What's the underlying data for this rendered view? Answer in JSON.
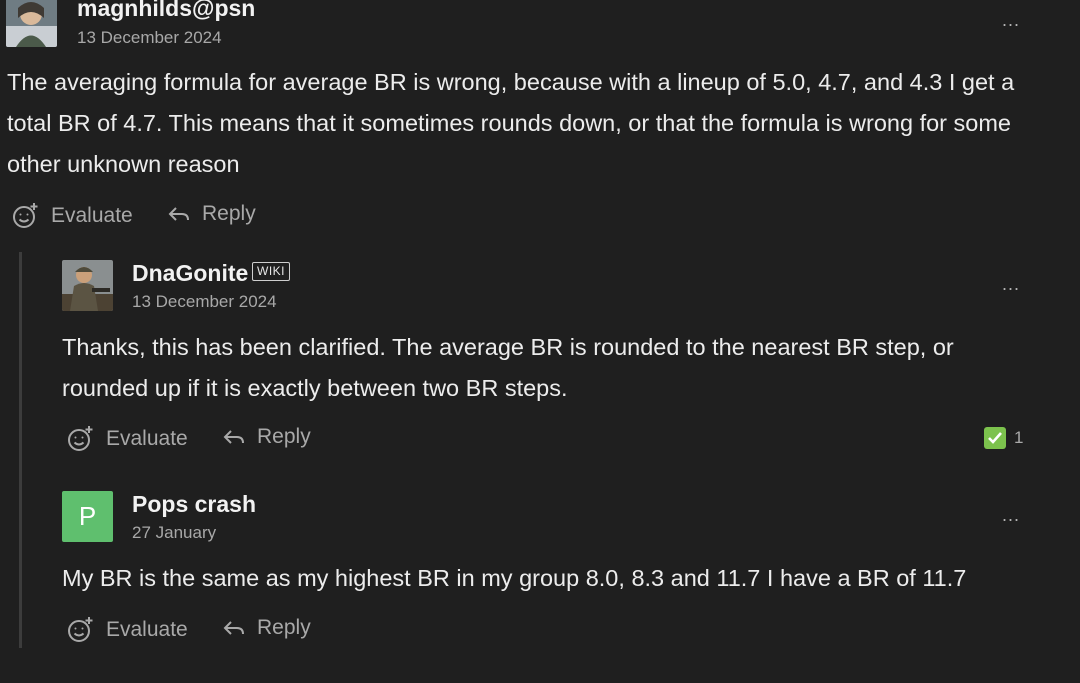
{
  "posts": [
    {
      "username": "magnhilds@psn",
      "date": "13 December 2024",
      "more": "...",
      "body": "The averaging formula for average BR is wrong, because with a lineup of 5.0, 4.7, and 4.3 I get a total BR of 4.7. This means that it sometimes rounds down, or that the formula is wrong for some other unknown reason",
      "evaluate_label": "Evaluate",
      "reply_label": "Reply"
    },
    {
      "username": "DnaGonite",
      "badge": "WIKI",
      "date": "13 December 2024",
      "more": "...",
      "body": "Thanks, this has been clarified. The average BR is rounded to the nearest BR step, or rounded up if it is exactly between two BR steps.",
      "evaluate_label": "Evaluate",
      "reply_label": "Reply",
      "solution_count": "1"
    },
    {
      "username": "Pops crash",
      "avatar_letter": "P",
      "date": "27 January",
      "more": "...",
      "body": "My BR is the same as my highest BR in my group 8.0, 8.3 and 11.7 I have a BR of 11.7",
      "evaluate_label": "Evaluate",
      "reply_label": "Reply"
    }
  ],
  "icons": {
    "evaluate": "smiley-plus-icon",
    "reply": "reply-arrow-icon",
    "solution": "check-icon",
    "more": "more-horizontal-icon"
  },
  "colors": {
    "background": "#1f1f1f",
    "text": "#ececec",
    "muted": "#a9a9a9",
    "thread_line": "#3c3c3c",
    "avatar_letter_bg": "#5fbf6e",
    "solution_check": "#7cc24d"
  }
}
